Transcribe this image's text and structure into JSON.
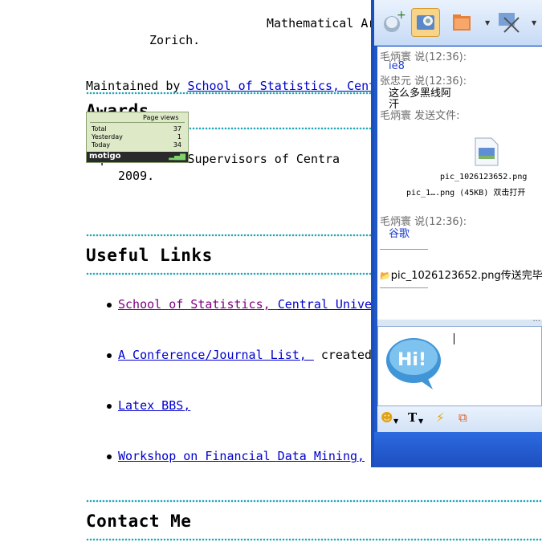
{
  "page": {
    "intro_line1": "Mathematical Ar",
    "intro_line2": "Zorich.",
    "maintained_prefix": "Maintained by ",
    "maintained_link": "School of Statistics, Cent",
    "awards_heading": "Awards",
    "award_line1": "Top 100 Class Supervisors of Centra",
    "award_line2": "2009.",
    "useful_heading": "Useful Links",
    "links": [
      {
        "text": "School of Statistics, ",
        "extra_link": "Central Unive",
        "visited": true
      },
      {
        "text": "A Conference/Journal List, ",
        "tail": "created"
      },
      {
        "text": "Latex BBS, "
      },
      {
        "text": "Workshop on Financial Data Mining, "
      }
    ],
    "contact_heading": "Contact Me"
  },
  "counter": {
    "title": "Page views",
    "rows": [
      {
        "label": "Total",
        "value": "37"
      },
      {
        "label": "Yesterday",
        "value": "1"
      },
      {
        "label": "Today",
        "value": "34"
      }
    ],
    "logo": "motigo"
  },
  "chat": {
    "messages": [
      {
        "who": "毛炳寰 说(12:36):",
        "text": "ie8"
      },
      {
        "who": "张忠元 说(12:36):",
        "text": "这么多黑线阿",
        "text2": "汗"
      },
      {
        "who": "毛炳寰 发送文件:"
      }
    ],
    "file_name": "pic_1026123652.png",
    "file_info": "pic_1….png (45KB) 双击打开",
    "msg_after": {
      "who": "毛炳寰 说(12:36):",
      "text": "谷歌"
    },
    "transfer_done": "pic_1026123652.png传送完毕",
    "input_ellipsis": "...",
    "bubble_text": "Hi!"
  },
  "colors": {
    "link": "#0000cc",
    "visited": "#800080",
    "accent_dots": "#22a7b8",
    "chat_frame": "#2058c8"
  }
}
